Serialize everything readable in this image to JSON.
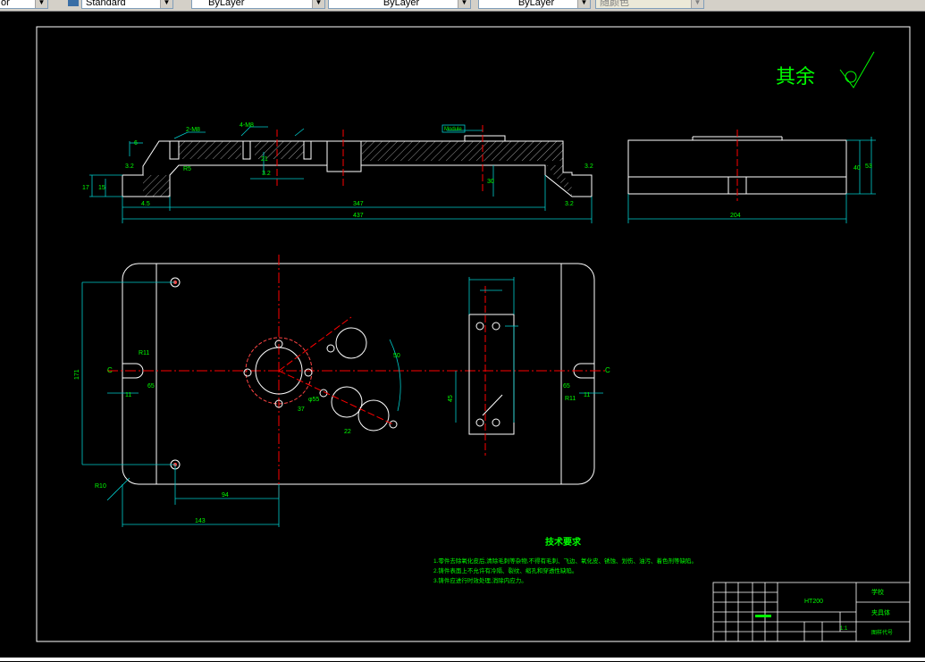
{
  "toolbar": {
    "combo1": "or",
    "textstyle": "Standard",
    "layer_color": "ByLayer",
    "linetype": "ByLayer",
    "lineweight": "ByLayer",
    "plotstyle": "随颜色"
  },
  "drawing": {
    "roughness_text": "其余",
    "dims_front": {
      "hole_label": "2-M8",
      "hole_label2": "4-M8",
      "d6": "6",
      "d17": "17",
      "d15": "15",
      "d45": "4.5",
      "d347": "347",
      "d437": "437",
      "d30": "30",
      "r5": "R5",
      "r32a": "3.2",
      "r32b": "3.2",
      "r32c": "3.2",
      "d21": "21",
      "d32": "3.2",
      "flag": "Module"
    },
    "dims_side": {
      "d204": "204",
      "d40": "40",
      "d53": "53"
    },
    "dims_plan": {
      "d171": "171",
      "d94": "94",
      "d143": "143",
      "r10": "R10",
      "r11a": "R11",
      "r11b": "R11",
      "d11a": "11",
      "d11b": "11",
      "d65a": "65",
      "d65b": "65",
      "d45": "45",
      "d55": "φ55",
      "c_left": "C",
      "c_right": "C",
      "d37": "37",
      "d22": "22",
      "d50": "50"
    },
    "tech_title": "技术要求",
    "tech_lines": [
      "1.零件去除氧化皮后,清除毛刺等杂物,不得有毛刺、飞边、氧化皮、锈蚀、划伤、油污、着色剂等缺陷。",
      "2.铸件表面上不允许有冷隔、裂纹、缩孔和穿透性缺陷。",
      "3.铸件应进行时效处理,消除内应力。"
    ],
    "title_block": {
      "material": "HT200",
      "scale": "1:1",
      "drawing_no_label": "图样代号",
      "company": "学校",
      "part_name": "夹具体"
    }
  }
}
